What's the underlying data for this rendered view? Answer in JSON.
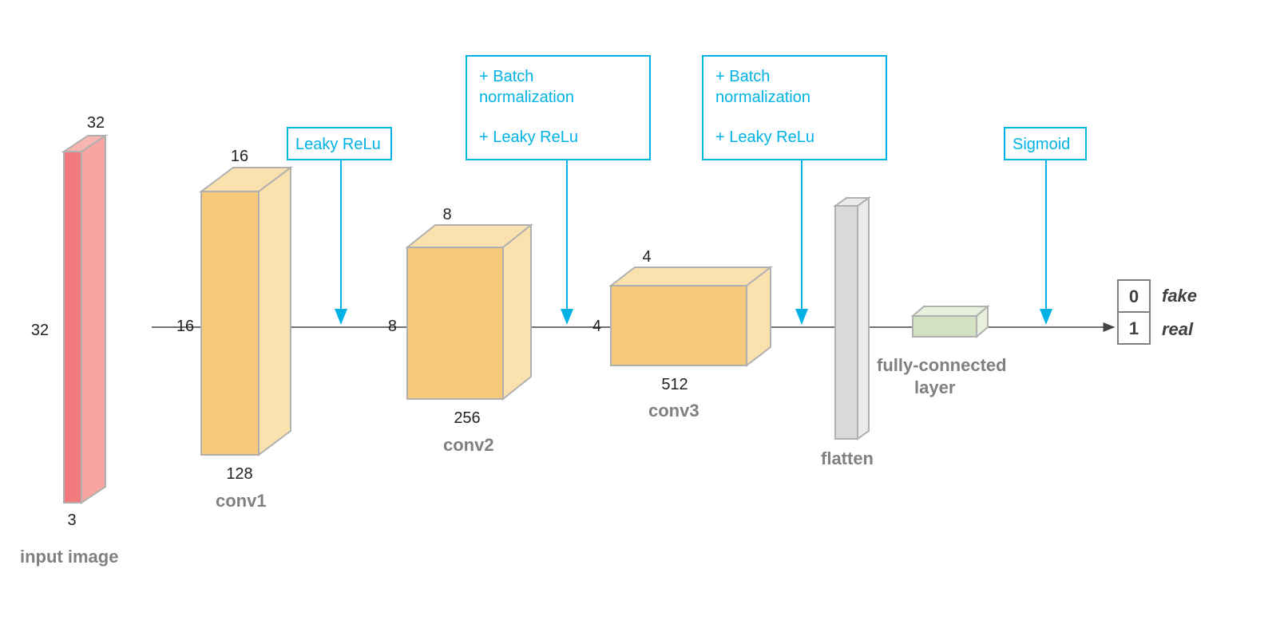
{
  "colors": {
    "input_face": "#f37b7e",
    "input_side": "#f7a5a1",
    "conv_face": "#f7c97a",
    "conv_side": "#fbe1ad",
    "flatten_face": "#d9d9d9",
    "flatten_side": "#ebebeb",
    "fc_face": "#d2e1c2",
    "fc_side": "#e8efdd",
    "stroke": "#b0b0b0",
    "arrow": "#444",
    "box_border": "#00b2e5",
    "box_fill": "#ffffff"
  },
  "layers": {
    "input": {
      "name": "input image",
      "w": "32",
      "h": "32",
      "c": "3"
    },
    "conv1": {
      "name": "conv1",
      "w": "16",
      "h": "16",
      "c": "128"
    },
    "conv2": {
      "name": "conv2",
      "w": "8",
      "h": "8",
      "c": "256"
    },
    "conv3": {
      "name": "conv3",
      "w": "4",
      "h": "4",
      "c": "512"
    },
    "flatten": {
      "name": "flatten"
    },
    "fc": {
      "name": "fully-connected layer"
    }
  },
  "activations": {
    "a1": {
      "lines": [
        "Leaky ReLu"
      ]
    },
    "a2": {
      "lines": [
        "+    Batch",
        "      normalization",
        "+    Leaky ReLu"
      ]
    },
    "a3": {
      "lines": [
        "+    Batch",
        "      normalization",
        "+    Leaky ReLu"
      ]
    },
    "a4": {
      "lines": [
        "Sigmoid"
      ]
    }
  },
  "output": {
    "fake": {
      "digit": "0",
      "label": "fake"
    },
    "real": {
      "digit": "1",
      "label": "real"
    }
  }
}
